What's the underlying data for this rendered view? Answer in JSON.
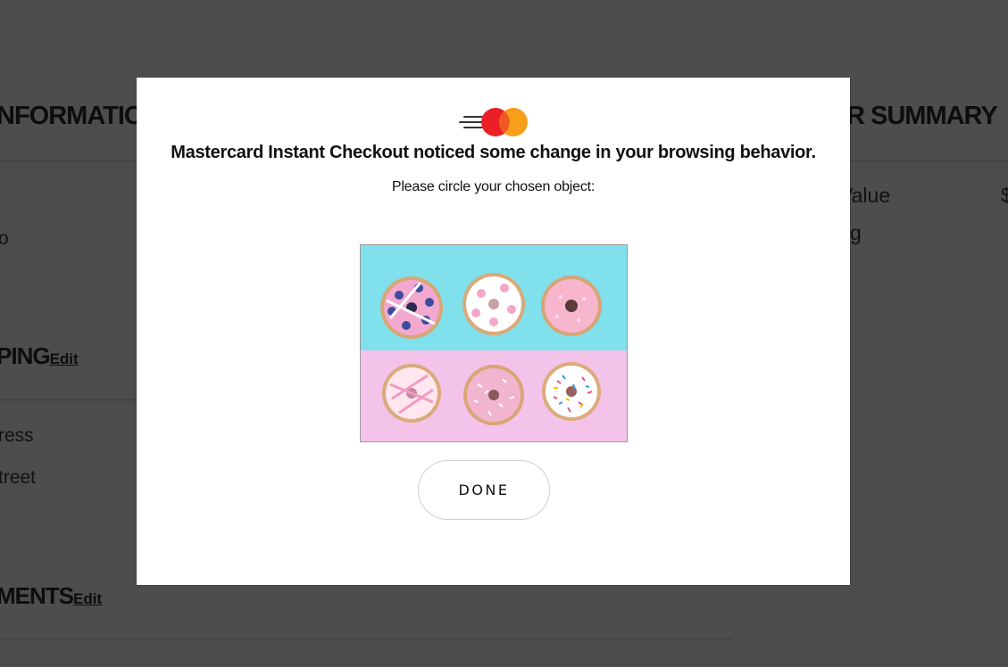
{
  "background": {
    "left_heading_1": "NFORMATION",
    "right_heading": "R SUMMARY",
    "left_text_1": "o",
    "right_text_1": "Value",
    "right_text_1_value": "$",
    "right_text_2": "g",
    "left_heading_2": "PING",
    "left_heading_2_edit": "Edit",
    "left_text_2": "ress",
    "left_text_3": "treet",
    "left_heading_3": "MENTS",
    "left_heading_3_edit": "Edit"
  },
  "modal": {
    "logo_icon": "mastercard-instant-checkout-logo",
    "title": "Mastercard Instant Checkout noticed some change in your browsing behavior.",
    "subtitle": "Please circle your chosen object:",
    "image_icon": "donuts-photo",
    "done_label": "DONE"
  },
  "colors": {
    "overlay": "#4d4d4d",
    "mastercard_red": "#eb2027",
    "mastercard_orange": "#f79e1b",
    "photo_top": "#7fe0ec",
    "photo_bottom": "#f4c4ea"
  }
}
